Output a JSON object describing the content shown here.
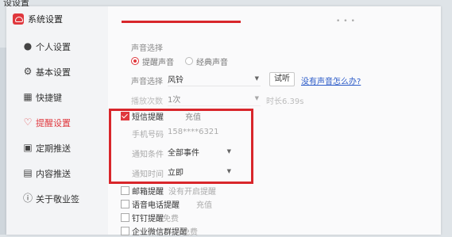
{
  "desktop": {
    "title": "设设置"
  },
  "app": {
    "title": "系统设置"
  },
  "menu": [
    {
      "label": "个人设置",
      "icon": "user-icon"
    },
    {
      "label": "基本设置",
      "icon": "gear-icon"
    },
    {
      "label": "快捷键",
      "icon": "keyboard-icon"
    },
    {
      "label": "提醒设置",
      "icon": "bell-icon",
      "active": true
    },
    {
      "label": "定期推送",
      "icon": "calendar-icon"
    },
    {
      "label": "内容推送",
      "icon": "document-icon"
    },
    {
      "label": "关于敬业签",
      "icon": "info-icon"
    }
  ],
  "sound": {
    "section_label": "声音选择",
    "option_reminder": "提醒声音",
    "option_classic": "经典声音",
    "select_label": "声音选择",
    "select_value": "风铃",
    "test_button": "试听",
    "help_link": "没有声音怎么办?"
  },
  "playcount": {
    "label": "播放次数",
    "value": "1次",
    "duration": "时长6.39s"
  },
  "sms": {
    "checkbox_label": "短信提醒",
    "recharge": "充值",
    "phone_label": "手机号码",
    "phone_value": "158****6321",
    "condition_label": "通知条件",
    "condition_value": "全部事件",
    "time_label": "通知时间",
    "time_value": "立即"
  },
  "others": [
    {
      "label": "邮箱提醒",
      "extra": "   没有开启提醒"
    },
    {
      "label": "语音电话提醒",
      "extra": "充值"
    },
    {
      "label": "钉钉提醒",
      "extra": "免费"
    },
    {
      "label": "企业微信群提醒",
      "extra": "免费"
    }
  ],
  "colors": {
    "accent": "#e0383e",
    "highlight": "#d8262b",
    "link": "#2a5ac8"
  }
}
